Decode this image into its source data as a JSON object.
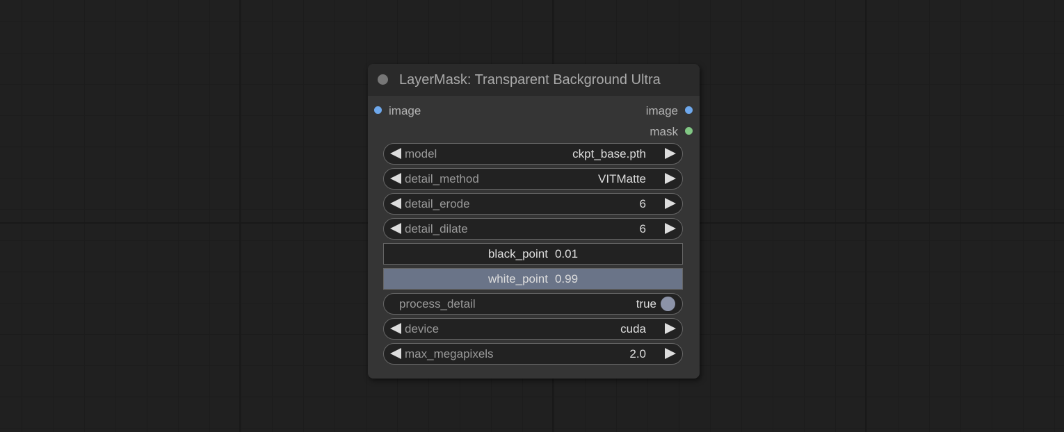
{
  "node": {
    "title": "LayerMask: Transparent Background Ultra",
    "inputs": [
      {
        "label": "image",
        "color": "#6ea8ec"
      }
    ],
    "outputs": [
      {
        "label": "image",
        "color": "#6ea8ec"
      },
      {
        "label": "mask",
        "color": "#81c784"
      }
    ],
    "widgets": {
      "model": {
        "label": "model",
        "value": "ckpt_base.pth"
      },
      "detail_method": {
        "label": "detail_method",
        "value": "VITMatte"
      },
      "detail_erode": {
        "label": "detail_erode",
        "value": "6"
      },
      "detail_dilate": {
        "label": "detail_dilate",
        "value": "6"
      },
      "black_point": {
        "label": "black_point",
        "value": "0.01"
      },
      "white_point": {
        "label": "white_point",
        "value": "0.99"
      },
      "process_detail": {
        "label": "process_detail",
        "value": "true"
      },
      "device": {
        "label": "device",
        "value": "cuda"
      },
      "max_megapixels": {
        "label": "max_megapixels",
        "value": "2.0"
      }
    }
  },
  "colors": {
    "canvas_bg": "#202020",
    "node_bg": "#353535",
    "title_bg": "#2a2a2a",
    "widget_bg": "#222222",
    "slider_fill": "#6a7488",
    "toggle_on": "#8c93a8"
  }
}
